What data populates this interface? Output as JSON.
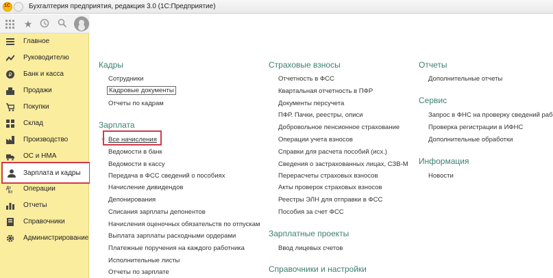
{
  "window": {
    "title": "Бухгалтерия предприятия, редакция 3.0  (1С:Предприятие)"
  },
  "sidebar": {
    "items": [
      {
        "label": "Главное",
        "icon": "menu-icon",
        "color": "#444444"
      },
      {
        "label": "Руководителю",
        "icon": "chart-line-icon",
        "color": "#444444"
      },
      {
        "label": "Банк и касса",
        "icon": "ruble-coin-icon",
        "color": "#444444"
      },
      {
        "label": "Продажи",
        "icon": "cash-register-icon",
        "color": "#444444"
      },
      {
        "label": "Покупки",
        "icon": "cart-icon",
        "color": "#444444"
      },
      {
        "label": "Склад",
        "icon": "warehouse-icon",
        "color": "#444444"
      },
      {
        "label": "Производство",
        "icon": "factory-icon",
        "color": "#444444"
      },
      {
        "label": "ОС и НМА",
        "icon": "truck-icon",
        "color": "#444444"
      },
      {
        "label": "Зарплата и кадры",
        "icon": "person-icon",
        "color": "#444444",
        "active": true
      },
      {
        "label": "Операции",
        "icon": "dt-kt-icon",
        "color": "#444444"
      },
      {
        "label": "Отчеты",
        "icon": "bar-chart-icon",
        "color": "#444444"
      },
      {
        "label": "Справочники",
        "icon": "book-icon",
        "color": "#444444"
      },
      {
        "label": "Администрирование",
        "icon": "gear-icon",
        "color": "#444444"
      }
    ]
  },
  "sections": {
    "kadry": {
      "title": "Кадры",
      "links": [
        "Сотрудники",
        "Кадровые документы",
        "Отчеты по кадрам"
      ]
    },
    "zarplata": {
      "title": "Зарплата",
      "links": [
        "Все начисления",
        "Ведомости в банк",
        "Ведомости в кассу",
        "Передача в ФСС сведений о пособиях",
        "Начисление дивидендов",
        "Депонирования",
        "Списания зарплаты депонентов",
        "Начисления оценочных обязательств по отпускам",
        "Выплата зарплаты расходными ордерами",
        "Платежные поручения на каждого работника",
        "Исполнительные листы",
        "Отчеты по зарплате"
      ]
    },
    "strakhovye": {
      "title": "Страховые взносы",
      "links": [
        "Отчетность в ФСС",
        "Квартальная отчетность в ПФР",
        "Документы персучета",
        "ПФР. Пачки, реестры, описи",
        "Добровольное пенсионное страхование",
        "Операции учета взносов",
        "Справки для расчета пособий (исх.)",
        "Сведения о застрахованных лицах, СЗВ-М",
        "Перерасчеты страховых взносов",
        "Акты проверок страховых взносов",
        "Реестры ЭЛН для отправки в ФСС",
        "Пособия за счет ФСС"
      ]
    },
    "zarplatnye": {
      "title": "Зарплатные проекты",
      "links": [
        "Ввод лицевых счетов"
      ]
    },
    "spravochniki": {
      "title": "Справочники и настройки",
      "links": []
    },
    "otchety": {
      "title": "Отчеты",
      "links": [
        "Дополнительные отчеты"
      ]
    },
    "servis": {
      "title": "Сервис",
      "links": [
        "Запрос в ФНС на проверку сведений работн",
        "Проверка регистрации в ИФНС",
        "Дополнительные обработки"
      ]
    },
    "informatsiya": {
      "title": "Информация",
      "links": [
        "Новости"
      ]
    }
  },
  "colors": {
    "sidebar_bg": "#fbed9e",
    "section_title": "#3b7f6e",
    "highlight": "#d0394a"
  }
}
